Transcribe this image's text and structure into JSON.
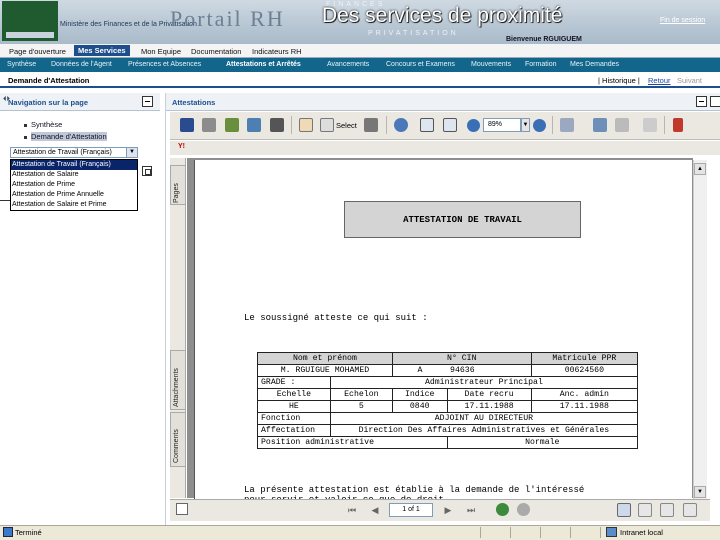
{
  "header": {
    "slide_title": "Des services de proximité",
    "brand": "Portail RH",
    "ministry": "Ministère des Finances et de la Privatisation",
    "brand_top": "FINANCES",
    "brand_bottom": "PRIVATISATION",
    "logout": "Fin de session",
    "welcome": "Bienvenue RGUIGUEM"
  },
  "main_nav": [
    {
      "label": "Page d'ouverture"
    },
    {
      "label": "Mes Services",
      "active": true
    },
    {
      "label": "Mon Equipe"
    },
    {
      "label": "Documentation"
    },
    {
      "label": "Indicateurs RH"
    }
  ],
  "sub_nav": [
    {
      "label": "Synthèse"
    },
    {
      "label": "Données de l'Agent"
    },
    {
      "label": "Présences et Absences"
    },
    {
      "label": "Attestations et Arrêtés",
      "active": true
    },
    {
      "label": "Avancements"
    },
    {
      "label": "Concours et Examens"
    },
    {
      "label": "Mouvements"
    },
    {
      "label": "Formation"
    },
    {
      "label": "Mes Demandes"
    }
  ],
  "breadcrumb": {
    "page": "Demande d'Attestation",
    "history": "Historique",
    "back": "Retour",
    "next": "Suivant"
  },
  "left_panel": {
    "title": "Navigation sur la page",
    "items": [
      "Synthèse",
      "Demande d'Attestation"
    ],
    "select_value": "Attestation de Travail (Français)",
    "options": [
      "Attestation de Travail (Français)",
      "Attestation de Salaire",
      "Attestation de Prime",
      "Attestation de Prime Annuelle",
      "Attestation de Salaire et Prime"
    ]
  },
  "right_panel": {
    "title": "Attestations"
  },
  "pdf_toolbar": {
    "select_label": "Select",
    "zoom": "89%",
    "search_brand": "Y!"
  },
  "side_tabs": [
    "Pages",
    "Attachments",
    "Comments"
  ],
  "document": {
    "heading": "ATTESTATION DE TRAVAIL",
    "intro": "Le soussigné atteste ce qui suit :",
    "table": {
      "h1": [
        "Nom et prénom",
        "N° CIN",
        "Matricule PPR"
      ],
      "r1": [
        "M. RGUIGUE MOHAMED",
        "A",
        "94636",
        "00624560"
      ],
      "grade_label": "GRADE :",
      "grade_value": "Administrateur Principal",
      "h2": [
        "Echelle",
        "Echelon",
        "Indice",
        "Date recru",
        "Anc. admin"
      ],
      "r2": [
        "HE",
        "5",
        "0840",
        "17.11.1988",
        "17.11.1988"
      ],
      "fonction_label": "Fonction",
      "fonction_value": "ADJOINT AU DIRECTEUR",
      "affectation_label": "Affectation",
      "affectation_value": "Direction Des Affaires Administratives et Générales",
      "position_label": "Position administrative",
      "position_value": "Normale"
    },
    "closing_1": "La présente attestation est établie à la demande de l'intéressé",
    "closing_2": "pour servir et valoir ce que de droit."
  },
  "pdf_nav": {
    "page_indicator": "1 of 1"
  },
  "status_bar": {
    "status": "Terminé",
    "zone": "Intranet local"
  },
  "colors": {
    "nav_active": "#1d4f8c",
    "subnav_bg": "#13668b",
    "logo_green": "#1f5b2e",
    "status_bg": "#ece9d8"
  }
}
